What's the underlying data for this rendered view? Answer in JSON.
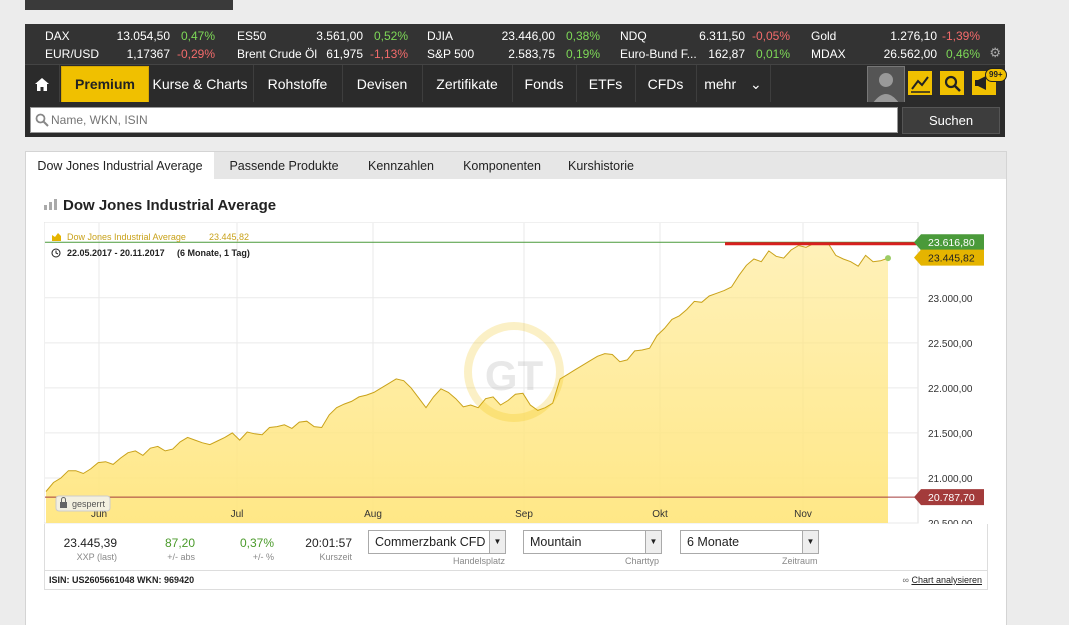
{
  "ticker": [
    {
      "name": "DAX",
      "value": "13.054,50",
      "change": "0,47%",
      "dir": "pos"
    },
    {
      "name": "EUR/USD",
      "value": "1,17367",
      "change": "-0,29%",
      "dir": "neg"
    },
    {
      "name": "ES50",
      "value": "3.561,00",
      "change": "0,52%",
      "dir": "pos"
    },
    {
      "name": "Brent Crude Öl",
      "value": "61,975",
      "change": "-1,13%",
      "dir": "neg"
    },
    {
      "name": "DJIA",
      "value": "23.446,00",
      "change": "0,38%",
      "dir": "pos"
    },
    {
      "name": "S&P 500",
      "value": "2.583,75",
      "change": "0,19%",
      "dir": "pos"
    },
    {
      "name": "NDQ",
      "value": "6.311,50",
      "change": "-0,05%",
      "dir": "neg"
    },
    {
      "name": "Euro-Bund F...",
      "value": "162,87",
      "change": "0,01%",
      "dir": "pos"
    },
    {
      "name": "Gold",
      "value": "1.276,10",
      "change": "-1,39%",
      "dir": "neg"
    },
    {
      "name": "MDAX",
      "value": "26.562,00",
      "change": "0,46%",
      "dir": "pos"
    }
  ],
  "nav": {
    "home_icon": "home-icon",
    "items": [
      "Premium",
      "Kurse & Charts",
      "Rohstoffe",
      "Devisen",
      "Zertifikate",
      "Fonds",
      "ETFs",
      "CFDs",
      "mehr"
    ],
    "badge": "99+"
  },
  "search": {
    "placeholder": "Name, WKN, ISIN",
    "button": "Suchen"
  },
  "tabs": [
    "Dow Jones Industrial Average",
    "Passende Produkte",
    "Kennzahlen",
    "Komponenten",
    "Kurshistorie"
  ],
  "page_title": "Dow Jones Industrial Average",
  "chart_data": {
    "type": "area",
    "series_label": "Dow Jones Industrial Average",
    "series_value": "23.445,82",
    "date_range": "22.05.2017 - 20.11.2017",
    "range_note": "(6 Monate, 1 Tag)",
    "x_ticks": [
      "Jun",
      "Jul",
      "Aug",
      "Sep",
      "Okt",
      "Nov"
    ],
    "y_ticks": [
      "23.000,00",
      "22.500,00",
      "22.000,00",
      "21.500,00",
      "21.000,00",
      "20.500,00"
    ],
    "ylim": [
      20500,
      23830
    ],
    "high_label": "23.616,80",
    "high": 23616.8,
    "low_label": "20.787,70",
    "low": 20787.7,
    "last_label": "23.445,82",
    "last": 23445.82,
    "locked_label": "gesperrt",
    "colors": {
      "fill": "#ffe680",
      "line": "#c9a21a",
      "high": "#4a9a3a",
      "low": "#a33b3b",
      "last": "#e5b400",
      "marker": "#d81f1f"
    },
    "values": [
      20850,
      20950,
      21000,
      21080,
      21080,
      21050,
      21100,
      21170,
      21180,
      21150,
      21220,
      21280,
      21300,
      21250,
      21330,
      21350,
      21300,
      21320,
      21400,
      21450,
      21420,
      21390,
      21370,
      21410,
      21450,
      21500,
      21420,
      21510,
      21490,
      21480,
      21560,
      21570,
      21590,
      21550,
      21620,
      21630,
      21570,
      21560,
      21700,
      21780,
      21820,
      21850,
      21900,
      21920,
      21950,
      22000,
      22050,
      22100,
      22080,
      22000,
      21890,
      21780,
      21900,
      21990,
      21950,
      21880,
      21790,
      21810,
      21780,
      21880,
      21900,
      21810,
      21860,
      21930,
      21940,
      21810,
      21750,
      21780,
      21830,
      22100,
      22150,
      22200,
      22250,
      22300,
      22350,
      22380,
      22370,
      22290,
      22310,
      22410,
      22420,
      22440,
      22580,
      22660,
      22760,
      22800,
      22870,
      22960,
      22950,
      23020,
      23050,
      23080,
      23120,
      23250,
      23360,
      23430,
      23400,
      23520,
      23460,
      23440,
      23530,
      23580,
      23560,
      23600,
      23600,
      23600,
      23470,
      23430,
      23400,
      23350,
      23470,
      23400,
      23410,
      23440
    ]
  },
  "info": {
    "price": "23.445,39",
    "price_lbl": "XXP (last)",
    "abs": "87,20",
    "abs_lbl": "+/- abs",
    "pct": "0,37%",
    "pct_lbl": "+/- %",
    "time": "20:01:57",
    "time_lbl": "Kurszeit",
    "venue": "Commerzbank CFD",
    "venue_lbl": "Handelsplatz",
    "charttype": "Mountain",
    "charttype_lbl": "Charttyp",
    "range": "6 Monate",
    "range_lbl": "Zeitraum"
  },
  "isin": "ISIN: US2605661048 WKN: 969420",
  "analyze_link": "Chart analysieren"
}
